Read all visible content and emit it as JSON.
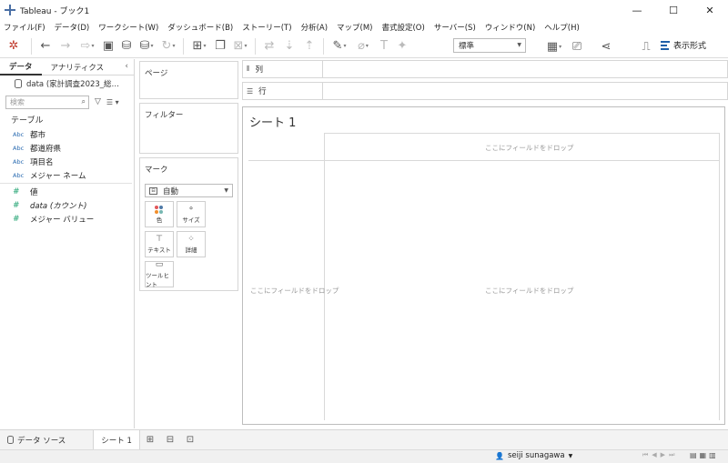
{
  "window": {
    "title": "Tableau - ブック1",
    "minimize": "—",
    "maximize": "☐",
    "close": "✕"
  },
  "menu": [
    "ファイル(F)",
    "データ(D)",
    "ワークシート(W)",
    "ダッシュボード(B)",
    "ストーリー(T)",
    "分析(A)",
    "マップ(M)",
    "書式設定(O)",
    "サーバー(S)",
    "ウィンドウ(N)",
    "ヘルプ(H)"
  ],
  "toolbar": {
    "fit_value": "標準",
    "show_me_label": "表示形式"
  },
  "data_pane": {
    "tab_data": "データ",
    "tab_analytics": "アナリティクス",
    "datasource": "data (家計調査2023_総…",
    "search_placeholder": "検索",
    "tables_header": "テーブル",
    "dimensions": [
      {
        "type": "Abc",
        "name": "都市"
      },
      {
        "type": "Abc",
        "name": "都道府県"
      },
      {
        "type": "Abc",
        "name": "項目名"
      },
      {
        "type": "Abc",
        "name": "メジャー ネーム"
      }
    ],
    "measures": [
      {
        "type": "#",
        "name": "値"
      },
      {
        "type": "#",
        "name": "data (カウント)"
      },
      {
        "type": "#",
        "name": "メジャー バリュー"
      }
    ]
  },
  "cards": {
    "pages": "ページ",
    "filters": "フィルター",
    "marks": "マーク",
    "mark_type": "自動",
    "mark_buttons": [
      "色",
      "サイズ",
      "テキスト",
      "詳細",
      "ツールヒント"
    ]
  },
  "shelves": {
    "columns": "列",
    "rows": "行"
  },
  "sheet": {
    "title": "シート 1",
    "drop_field_top": "ここにフィールドをドロップ",
    "drop_field_left": "ここにフィールドをドロップ",
    "drop_field_center": "ここにフィールドをドロップ"
  },
  "tabs": {
    "datasource": "データ ソース",
    "sheet1": "シート 1"
  },
  "status": {
    "user": "seiji sunagawa"
  },
  "colors": {
    "accent": "#1f5fa8",
    "dimension": "#2a6bb1",
    "measure": "#1aa06d"
  }
}
